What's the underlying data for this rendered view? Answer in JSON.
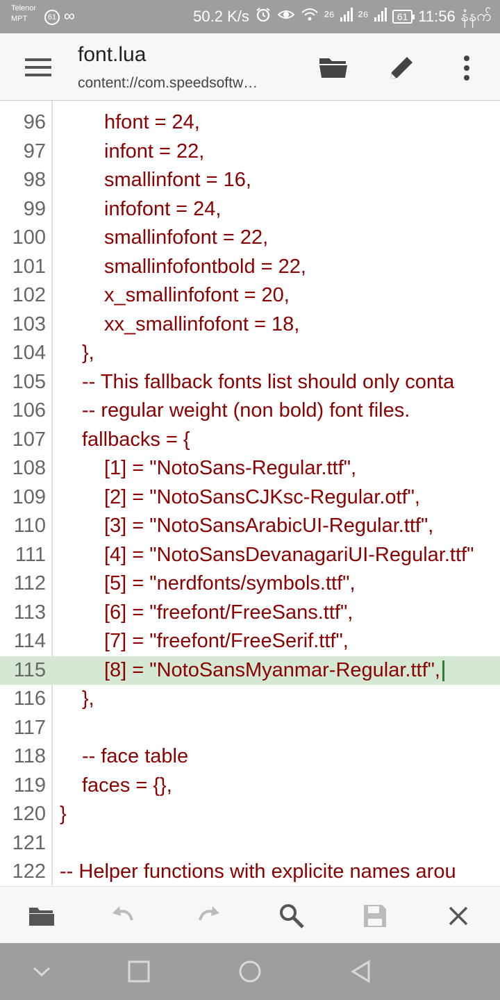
{
  "status": {
    "carrier_top": "Telenor",
    "carrier_bottom": "MPT",
    "notif_badge": "61",
    "infinity": "∞",
    "speed": "50.2 K/s",
    "net1": "²⁶",
    "net2": "²⁶",
    "battery": "61",
    "time": "11:56",
    "time_suffix": "နံနက်"
  },
  "toolbar": {
    "title": "font.lua",
    "subtitle": "content://com.speedsoftw…"
  },
  "editor": {
    "lines": [
      {
        "no": "96",
        "text": "hfont = 24,",
        "indent": 150
      },
      {
        "no": "97",
        "text": "infont = 22,",
        "indent": 150
      },
      {
        "no": "98",
        "text": "smallinfont = 16,",
        "indent": 150
      },
      {
        "no": "99",
        "text": "infofont = 24,",
        "indent": 150
      },
      {
        "no": "100",
        "text": "smallinfofont = 22,",
        "indent": 150
      },
      {
        "no": "101",
        "text": "smallinfofontbold = 22,",
        "indent": 150
      },
      {
        "no": "102",
        "text": "x_smallinfofont = 20,",
        "indent": 150
      },
      {
        "no": "103",
        "text": "xx_smallinfofont = 18,",
        "indent": 150
      },
      {
        "no": "104",
        "text": "},",
        "indent": 118
      },
      {
        "no": "105",
        "text": "-- This fallback fonts list should only conta",
        "indent": 118
      },
      {
        "no": "106",
        "text": "-- regular weight (non bold) font files.",
        "indent": 118
      },
      {
        "no": "107",
        "text": "fallbacks = {",
        "indent": 118
      },
      {
        "no": "108",
        "text": "[1] = \"NotoSans-Regular.ttf\",",
        "indent": 150
      },
      {
        "no": "109",
        "text": "[2] = \"NotoSansCJKsc-Regular.otf\",",
        "indent": 150
      },
      {
        "no": "110",
        "text": "[3] = \"NotoSansArabicUI-Regular.ttf\",",
        "indent": 150
      },
      {
        "no": "111",
        "text": "[4] = \"NotoSansDevanagariUI-Regular.ttf\"",
        "indent": 150
      },
      {
        "no": "112",
        "text": "[5] = \"nerdfonts/symbols.ttf\",",
        "indent": 150
      },
      {
        "no": "113",
        "text": "[6] = \"freefont/FreeSans.ttf\",",
        "indent": 150
      },
      {
        "no": "114",
        "text": "[7] = \"freefont/FreeSerif.ttf\",",
        "indent": 150
      },
      {
        "no": "115",
        "text": "[8] = \"NotoSansMyanmar-Regular.ttf\",",
        "indent": 150,
        "current": true
      },
      {
        "no": "116",
        "text": "},",
        "indent": 118
      },
      {
        "no": "117",
        "text": "",
        "indent": 118
      },
      {
        "no": "118",
        "text": "-- face table",
        "indent": 118
      },
      {
        "no": "119",
        "text": "faces = {},",
        "indent": 118
      },
      {
        "no": "120",
        "text": "}",
        "indent": 86
      },
      {
        "no": "121",
        "text": "",
        "indent": 86
      },
      {
        "no": "122",
        "text": "-- Helper functions with explicite names arou",
        "indent": 86
      }
    ]
  },
  "colors": {
    "code": "#8b0000",
    "current_line": "#d5e8d4",
    "bars": "#9e9e9e"
  }
}
